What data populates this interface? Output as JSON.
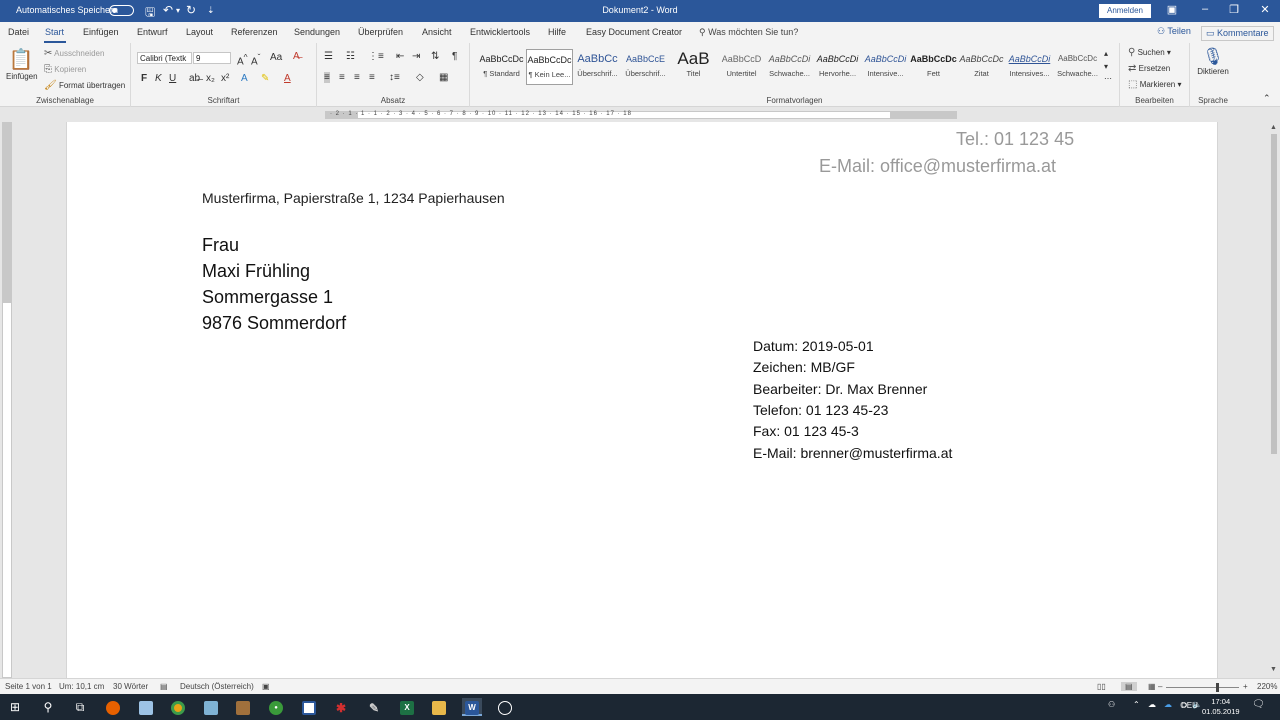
{
  "titlebar": {
    "autosave_label": "Automatisches Speichern",
    "doc_title": "Dokument2 - Word",
    "signin_label": "Anmelden",
    "qat_save_icon": "save-icon",
    "qat_undo_icon": "undo-icon",
    "qat_redo_icon": "redo-icon"
  },
  "tabs": {
    "items": [
      "Datei",
      "Start",
      "Entwurf",
      "Layout",
      "Referenzen",
      "Sendungen",
      "Überprüfen",
      "Ansicht",
      "Entwicklertools",
      "Hilfe",
      "Easy Document Creator"
    ],
    "active": "Start",
    "insert_tab": "Einfügen",
    "tell_me": "Was möchten Sie tun?",
    "share": "Teilen",
    "comments": "Kommentare"
  },
  "ribbon": {
    "clipboard": {
      "paste": "Einfügen",
      "cut": "Ausschneiden",
      "copy": "Kopieren",
      "format_painter": "Format übertragen",
      "label": "Zwischenablage"
    },
    "font": {
      "font_name": "Calibri (Textk",
      "font_size": "9",
      "bold": "F",
      "italic": "K",
      "underline": "U",
      "label": "Schriftart"
    },
    "paragraph": {
      "label": "Absatz"
    },
    "styles": {
      "label": "Formatvorlagen",
      "items": [
        {
          "preview": "AaBbCcDc",
          "name": "¶ Standard"
        },
        {
          "preview": "AaBbCcDc",
          "name": "¶ Kein Lee..."
        },
        {
          "preview": "AaBbCc",
          "name": "Überschrif..."
        },
        {
          "preview": "AaBbCcE",
          "name": "Überschrif..."
        },
        {
          "preview": "AaB",
          "name": "Titel"
        },
        {
          "preview": "AaBbCcD",
          "name": "Untertitel"
        },
        {
          "preview": "AaBbCcDi",
          "name": "Schwache..."
        },
        {
          "preview": "AaBbCcDi",
          "name": "Hervorhe..."
        },
        {
          "preview": "AaBbCcDi",
          "name": "Intensive..."
        },
        {
          "preview": "AaBbCcDc",
          "name": "Fett"
        },
        {
          "preview": "AaBbCcDc",
          "name": "Zitat"
        },
        {
          "preview": "AaBbCcDi",
          "name": "Intensives..."
        },
        {
          "preview": "AaBbCcDc",
          "name": "Schwache..."
        }
      ]
    },
    "editing": {
      "find": "Suchen",
      "replace": "Ersetzen",
      "select": "Markieren",
      "label": "Bearbeiten"
    },
    "voice": {
      "dictate": "Diktieren",
      "label": "Sprache"
    }
  },
  "ruler": {
    "numbers": "· 2 · 1 · 1 · 1 · 2 · 3 · 4 · 5 · 6 · 7 · 8 · 9 · 10 · 11 · 12 · 13 · 14 · 15 · 16 · 17 · 18"
  },
  "document": {
    "header_tel": "Tel.: 01 123 45",
    "header_email": "E-Mail: office@musterfirma.at",
    "sender_line": "Musterfirma, Papierstraße 1, 1234 Papierhausen",
    "recipient": [
      "Frau",
      "Maxi Frühling",
      "Sommergasse 1",
      "9876 Sommerdorf"
    ],
    "info_block": [
      "Datum: 2019-05-01",
      "Zeichen: MB/GF",
      "Bearbeiter: Dr. Max Brenner",
      "Telefon: 01 123 45-23",
      "Fax: 01 123 45-3",
      "E-Mail: brenner@musterfirma.at"
    ]
  },
  "statusbar": {
    "page": "Seite 1 von 1",
    "position": "Um: 10,1 cm",
    "words": "30 Wörter",
    "language": "Deutsch (Österreich)",
    "zoom": "220%"
  },
  "taskbar": {
    "lang": "DEU",
    "time": "17:04",
    "date": "01.05.2019"
  },
  "colors": {
    "accent": "#2b579a",
    "taskbar": "#1c2733"
  }
}
